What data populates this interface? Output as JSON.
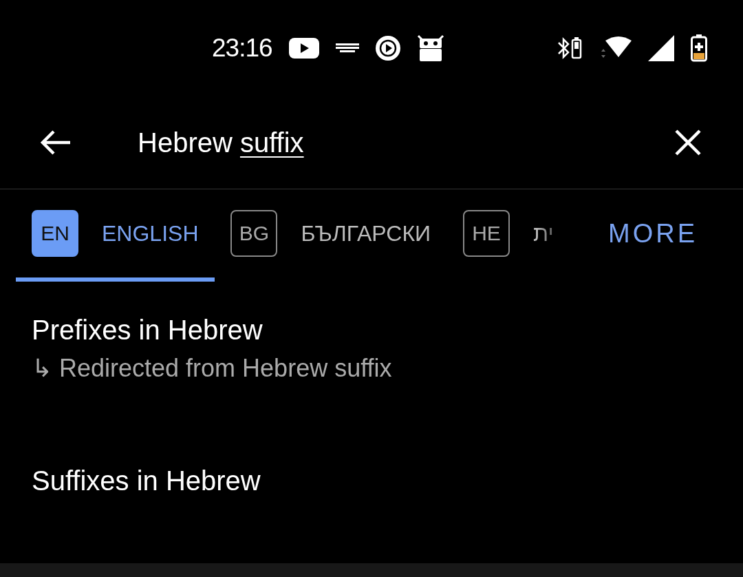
{
  "status_bar": {
    "time": "23:16"
  },
  "search": {
    "text": "Hebrew",
    "composing": "suffix"
  },
  "tabs": [
    {
      "code": "EN",
      "label": "ENGLISH",
      "selected": true
    },
    {
      "code": "BG",
      "label": "БЪЛГАРСКИ",
      "selected": false
    },
    {
      "code": "HE",
      "label": "ית",
      "selected": false
    }
  ],
  "more": "MORE",
  "results": [
    {
      "title": "Prefixes in Hebrew",
      "redirect": "↳ Redirected from Hebrew suffix"
    },
    {
      "title": "Suffixes in Hebrew"
    }
  ]
}
